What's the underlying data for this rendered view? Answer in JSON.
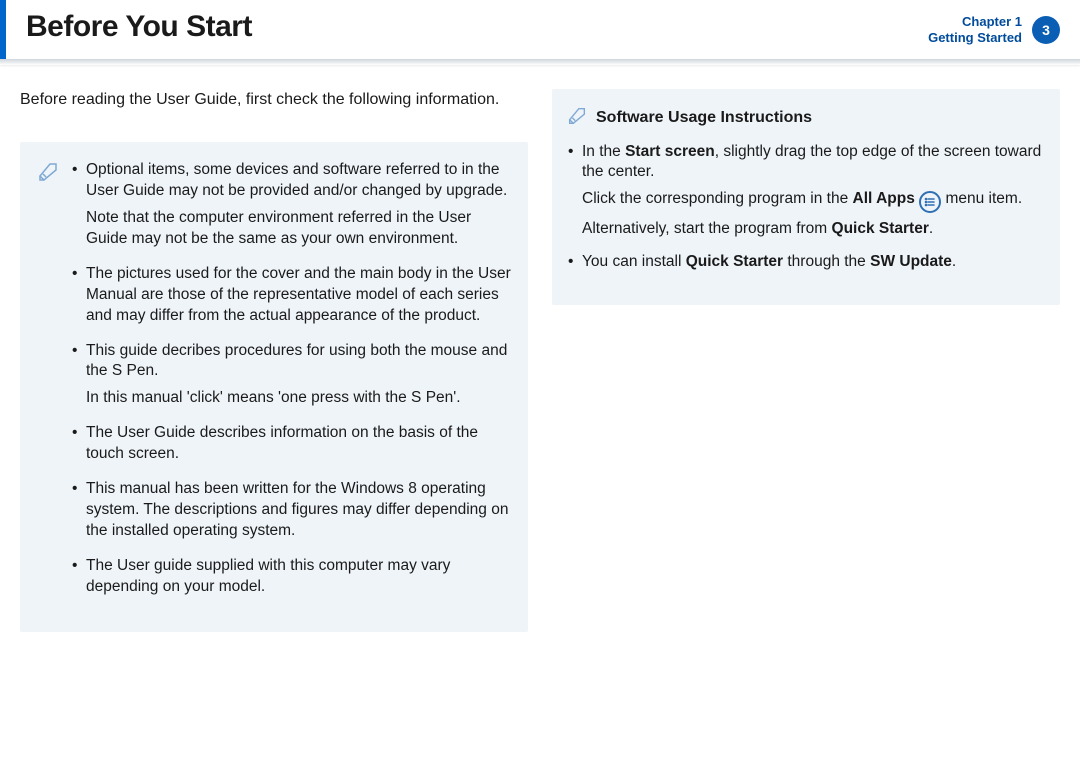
{
  "header": {
    "title": "Before You Start",
    "chapter_line1": "Chapter 1",
    "chapter_line2": "Getting Started",
    "page_number": "3"
  },
  "intro": "Before reading the User Guide, first check the following information.",
  "left_notes": [
    {
      "main": "Optional items, some devices and software referred to in the User Guide may not be provided and/or changed by upgrade.",
      "sub": "Note that the computer environment referred in the User Guide may not be the same as your own environment."
    },
    {
      "main": "The pictures used for the cover and the main body in the User Manual are those of the representative model of each series and may differ from the actual appearance of the product."
    },
    {
      "main": "This guide decribes procedures for using both the mouse and the S Pen.",
      "sub": "In this manual 'click' means 'one press with the S Pen'."
    },
    {
      "main": "The User Guide describes information on the basis of the touch screen."
    },
    {
      "main": "This manual has been written for the Windows 8 operating system. The descriptions and figures may differ depending on the installed operating system."
    },
    {
      "main": "The User guide supplied with this computer may vary depending on your model."
    }
  ],
  "right_box": {
    "title": "Software Usage Instructions",
    "item1": {
      "pre": "In the ",
      "bold1": "Start screen",
      "mid1": ", slightly drag the top edge of the screen toward the center.",
      "line2_pre": "Click the corresponding program in the ",
      "line2_bold": "All Apps",
      "line2_post": " menu item.",
      "line3_pre": "Alternatively, start the program from ",
      "line3_bold": "Quick Starter",
      "line3_post": "."
    },
    "item2": {
      "pre": "You can install ",
      "bold1": "Quick Starter",
      "mid": " through the ",
      "bold2": "SW Update",
      "post": "."
    }
  }
}
